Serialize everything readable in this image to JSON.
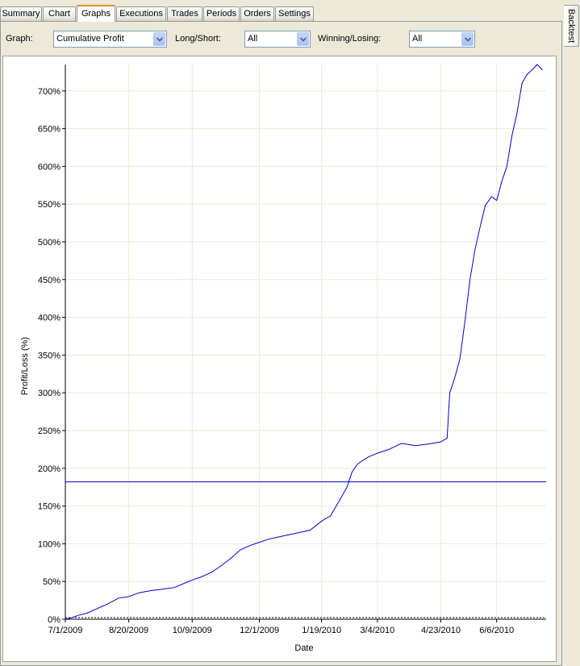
{
  "tabs": [
    {
      "label": "Summary",
      "active": false
    },
    {
      "label": "Chart",
      "active": false
    },
    {
      "label": "Graphs",
      "active": true
    },
    {
      "label": "Executions",
      "active": false
    },
    {
      "label": "Trades",
      "active": false
    },
    {
      "label": "Periods",
      "active": false
    },
    {
      "label": "Orders",
      "active": false
    },
    {
      "label": "Settings",
      "active": false
    }
  ],
  "side_tab": {
    "label": "Backtest"
  },
  "toolbar": {
    "graph_label": "Graph:",
    "graph_value": "Cumulative Profit",
    "longshort_label": "Long/Short:",
    "longshort_value": "All",
    "winlose_label": "Winning/Losing:",
    "winlose_value": "All"
  },
  "colors": {
    "accent_tab": "#e68b2c",
    "series": "#0000cc",
    "grid": "#ece9d8"
  },
  "chart_data": {
    "type": "line",
    "xlabel": "Date",
    "ylabel": "Profit/Loss (%)",
    "x_ticks": [
      "7/1/2009",
      "8/20/2009",
      "10/9/2009",
      "12/1/2009",
      "1/19/2010",
      "3/4/2010",
      "4/23/2010",
      "6/6/2010"
    ],
    "y_ticks": [
      "0%",
      "50%",
      "100%",
      "150%",
      "200%",
      "250%",
      "300%",
      "350%",
      "400%",
      "450%",
      "500%",
      "550%",
      "600%",
      "650%",
      "700%"
    ],
    "ylim": [
      0,
      735
    ],
    "xlim": [
      "2009-07-01",
      "2010-07-15"
    ],
    "grid": true,
    "average_line": 182,
    "series": [
      {
        "points": [
          [
            "2009-07-01",
            0
          ],
          [
            "2009-07-06",
            2
          ],
          [
            "2009-07-11",
            5
          ],
          [
            "2009-07-18",
            8
          ],
          [
            "2009-07-26",
            14
          ],
          [
            "2009-08-03",
            20
          ],
          [
            "2009-08-12",
            28
          ],
          [
            "2009-08-20",
            30
          ],
          [
            "2009-08-28",
            35
          ],
          [
            "2009-09-07",
            38
          ],
          [
            "2009-09-16",
            40
          ],
          [
            "2009-09-25",
            42
          ],
          [
            "2009-10-02",
            47
          ],
          [
            "2009-10-09",
            52
          ],
          [
            "2009-10-16",
            56
          ],
          [
            "2009-10-24",
            62
          ],
          [
            "2009-10-31",
            70
          ],
          [
            "2009-11-08",
            80
          ],
          [
            "2009-11-16",
            92
          ],
          [
            "2009-11-24",
            98
          ],
          [
            "2009-12-01",
            102
          ],
          [
            "2009-12-08",
            106
          ],
          [
            "2009-12-16",
            109
          ],
          [
            "2009-12-24",
            112
          ],
          [
            "2010-01-02",
            115
          ],
          [
            "2010-01-10",
            118
          ],
          [
            "2010-01-19",
            130
          ],
          [
            "2010-01-26",
            137
          ],
          [
            "2010-02-03",
            160
          ],
          [
            "2010-02-08",
            175
          ],
          [
            "2010-02-12",
            195
          ],
          [
            "2010-02-16",
            205
          ],
          [
            "2010-02-20",
            210
          ],
          [
            "2010-02-25",
            215
          ],
          [
            "2010-03-04",
            220
          ],
          [
            "2010-03-13",
            225
          ],
          [
            "2010-03-23",
            233
          ],
          [
            "2010-04-03",
            230
          ],
          [
            "2010-04-13",
            232
          ],
          [
            "2010-04-23",
            235
          ],
          [
            "2010-04-28",
            240
          ],
          [
            "2010-04-30",
            300
          ],
          [
            "2010-05-04",
            320
          ],
          [
            "2010-05-08",
            345
          ],
          [
            "2010-05-12",
            395
          ],
          [
            "2010-05-16",
            450
          ],
          [
            "2010-05-20",
            490
          ],
          [
            "2010-05-24",
            520
          ],
          [
            "2010-05-28",
            548
          ],
          [
            "2010-06-02",
            560
          ],
          [
            "2010-06-06",
            555
          ],
          [
            "2010-06-10",
            580
          ],
          [
            "2010-06-14",
            600
          ],
          [
            "2010-06-18",
            640
          ],
          [
            "2010-06-22",
            670
          ],
          [
            "2010-06-26",
            710
          ],
          [
            "2010-06-30",
            722
          ],
          [
            "2010-07-04",
            728
          ],
          [
            "2010-07-08",
            735
          ],
          [
            "2010-07-12",
            728
          ]
        ]
      }
    ]
  }
}
